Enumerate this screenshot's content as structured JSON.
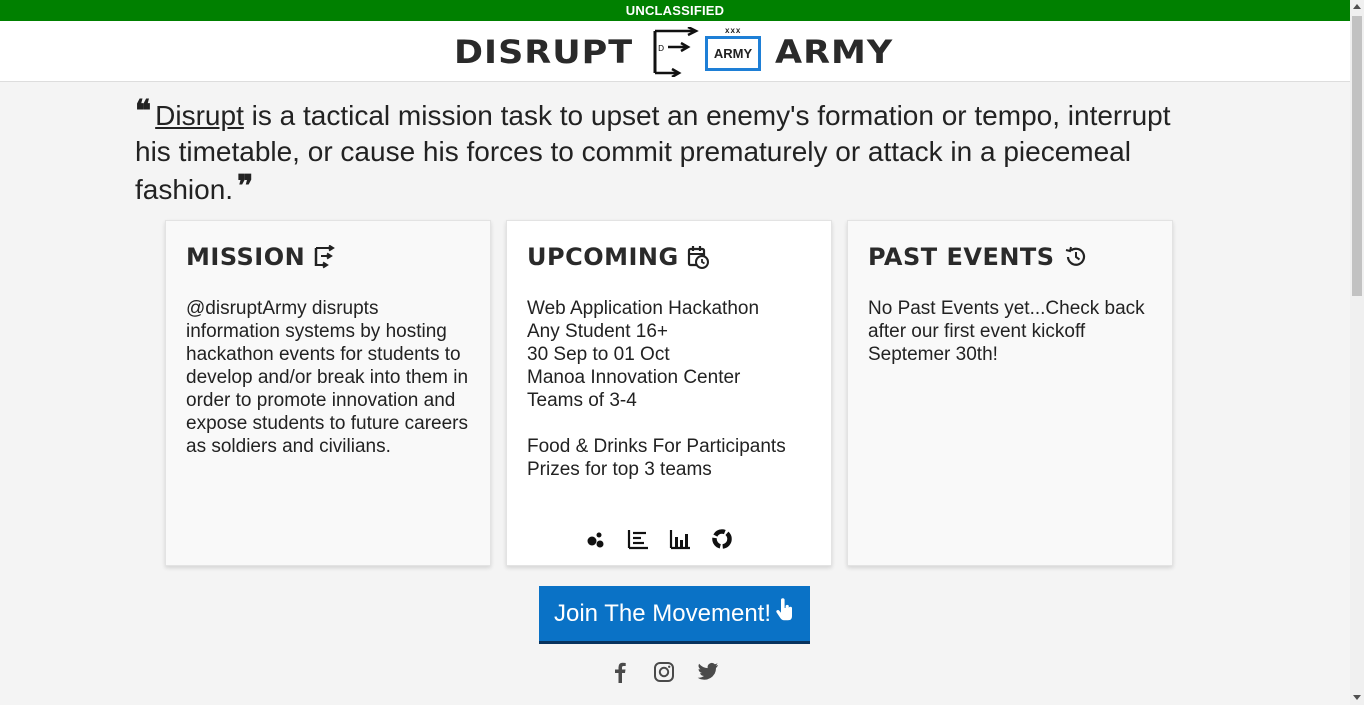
{
  "banner": {
    "text": "UNCLASSIFIED",
    "color": "#008000"
  },
  "logo": {
    "word_left": "DISRUPT",
    "word_right": "ARMY",
    "box_label": "ARMY",
    "box_echelon": "xxx",
    "box_color": "#1e7fd6",
    "symbol_letter": "D"
  },
  "quote": {
    "link_text": "Disrupt",
    "text": " is a tactical mission task to upset an enemy's formation or tempo, interrupt his timetable, or cause his forces to commit prematurely or attack in a piecemeal fashion."
  },
  "cards": {
    "mission": {
      "title": "MISSION",
      "icon": "disrupt-symbol-icon",
      "body": "@disruptArmy disrupts information systems by hosting hackathon events for students to develop and/or break into them in order to promote innovation and expose students to future careers as soldiers and civilians."
    },
    "upcoming": {
      "title": "UPCOMING",
      "icon": "calendar-clock-icon",
      "lines": [
        "Web Application Hackathon",
        "Any Student 16+",
        "30 Sep to 01 Oct",
        "Manoa Innovation Center",
        "Teams of 3-4",
        "",
        "Food & Drinks For Participants",
        "Prizes for top 3 teams"
      ],
      "stat_icons": [
        "bubble-chart-icon",
        "list-chart-icon",
        "bar-chart-icon",
        "donut-chart-icon"
      ]
    },
    "past": {
      "title": "PAST EVENTS",
      "icon": "history-icon",
      "body": "No Past Events yet...Check back after our first event kickoff Septemer 30th!"
    }
  },
  "cta": {
    "label": "Join The Movement!",
    "icon": "pointer-hand-icon",
    "color": "#0a72c6"
  },
  "social": [
    "facebook-icon",
    "instagram-icon",
    "twitter-icon"
  ]
}
